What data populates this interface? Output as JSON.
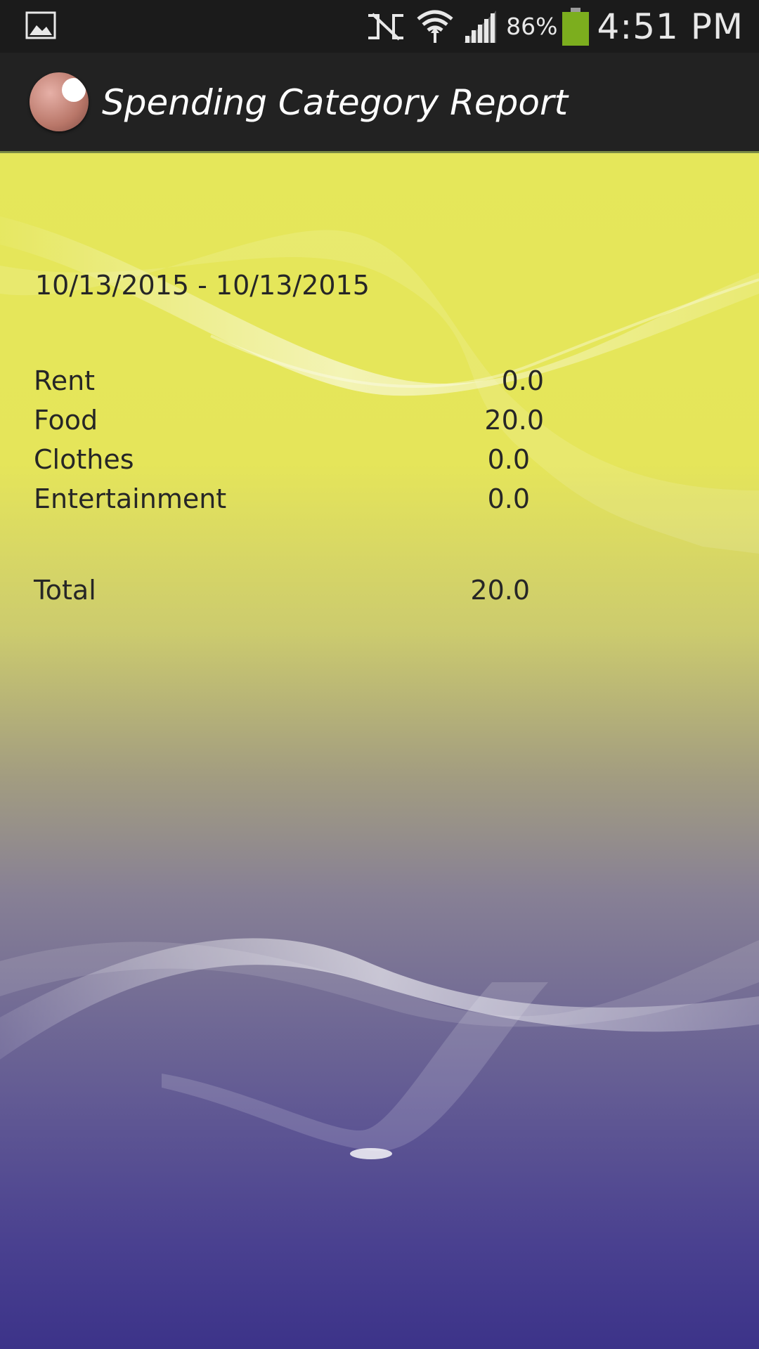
{
  "status_bar": {
    "battery_percent": "86%",
    "time": "4:51 PM",
    "battery_color": "#7cae1e"
  },
  "action_bar": {
    "title": "Spending Category Report"
  },
  "report": {
    "date_range": "10/13/2015 - 10/13/2015",
    "categories": [
      {
        "label": "Rent",
        "value": "0.0"
      },
      {
        "label": "Food",
        "value": "20.0"
      },
      {
        "label": "Clothes",
        "value": "0.0"
      },
      {
        "label": "Entertainment",
        "value": "0.0"
      }
    ],
    "total_label": "Total",
    "total_value": "20.0"
  }
}
